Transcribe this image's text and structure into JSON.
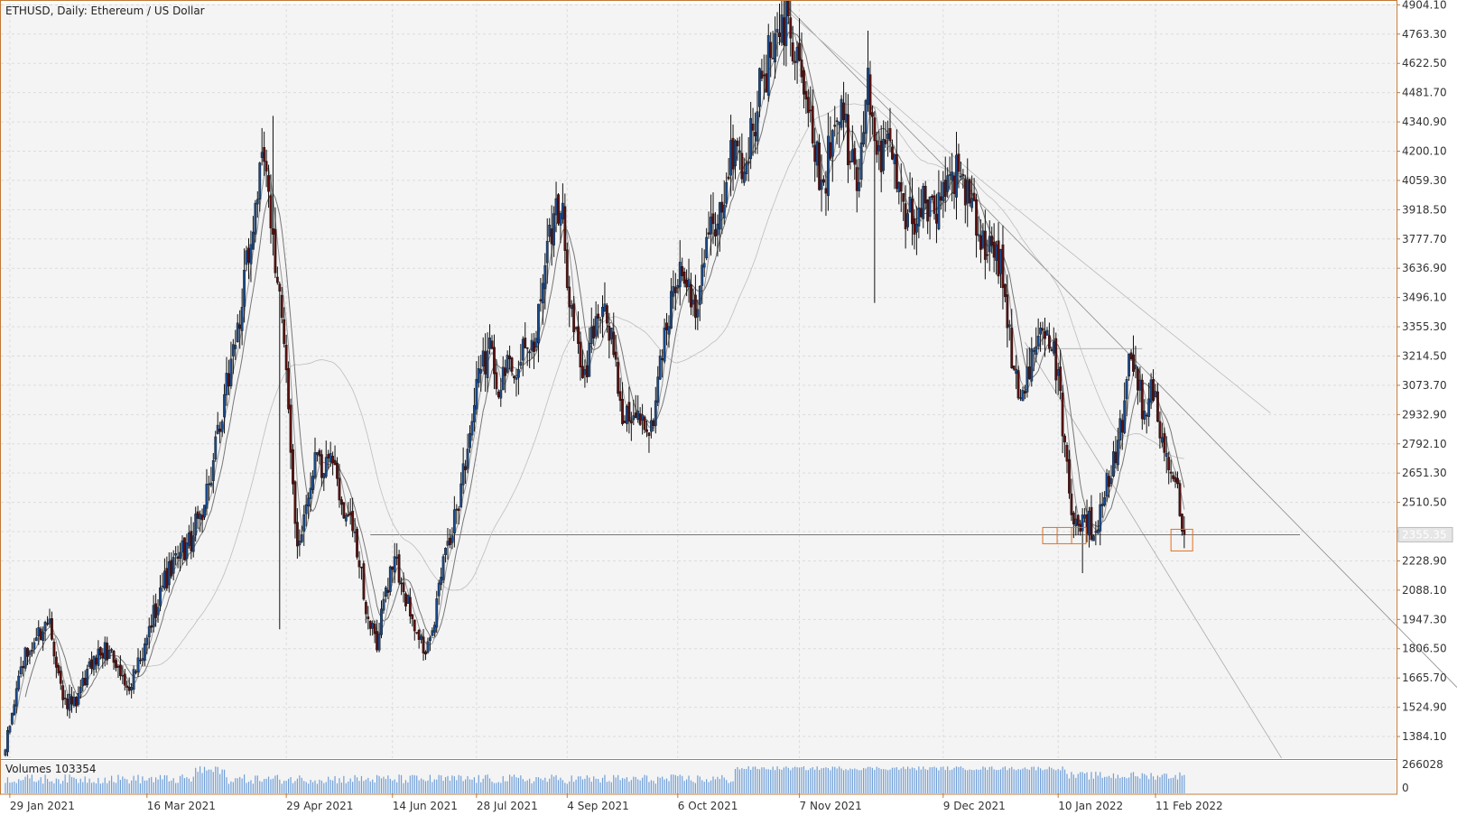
{
  "chart_data": {
    "type": "candlestick",
    "title": "ETHUSD, Daily:  Ethereum / US Dollar",
    "price_ylim": [
      1280,
      4910
    ],
    "y_ticks": [
      "4904.10",
      "4763.30",
      "4622.50",
      "4481.70",
      "4340.90",
      "4200.10",
      "4059.30",
      "3918.50",
      "3777.70",
      "3636.90",
      "3496.10",
      "3355.30",
      "3214.50",
      "3073.70",
      "2932.90",
      "2792.10",
      "2651.30",
      "2510.50",
      "2369.70",
      "2228.90",
      "2088.10",
      "1947.30",
      "1806.50",
      "1665.70",
      "1524.90",
      "1384.10"
    ],
    "x_labels": [
      "29 Jan 2021",
      "16 Mar 2021",
      "29 Apr 2021",
      "14 Jun 2021",
      "28 Jul 2021",
      "4 Sep 2021",
      "6 Oct 2021",
      "7 Nov 2021",
      "9 Dec 2021",
      "10 Jan 2022",
      "11 Feb 2022"
    ],
    "current_price_label": "2355.35",
    "support_level": 2355,
    "grid": true,
    "anchors": [
      [
        0,
        1320
      ],
      [
        7,
        1720
      ],
      [
        14,
        1860
      ],
      [
        20,
        1950
      ],
      [
        26,
        1560
      ],
      [
        32,
        1530
      ],
      [
        40,
        1770
      ],
      [
        47,
        1800
      ],
      [
        55,
        1620
      ],
      [
        62,
        1760
      ],
      [
        70,
        2100
      ],
      [
        78,
        2240
      ],
      [
        85,
        2350
      ],
      [
        92,
        2600
      ],
      [
        98,
        2900
      ],
      [
        102,
        3200
      ],
      [
        107,
        3450
      ],
      [
        113,
        3950
      ],
      [
        117,
        4150
      ],
      [
        121,
        3800
      ],
      [
        125,
        3400
      ],
      [
        129,
        2750
      ],
      [
        132,
        2300
      ],
      [
        136,
        2500
      ],
      [
        140,
        2750
      ],
      [
        144,
        2650
      ],
      [
        148,
        2700
      ],
      [
        152,
        2500
      ],
      [
        156,
        2450
      ],
      [
        160,
        2200
      ],
      [
        164,
        1950
      ],
      [
        168,
        1800
      ],
      [
        172,
        2100
      ],
      [
        176,
        2250
      ],
      [
        180,
        2080
      ],
      [
        184,
        1950
      ],
      [
        187,
        1850
      ],
      [
        190,
        1780
      ],
      [
        194,
        1920
      ],
      [
        198,
        2250
      ],
      [
        202,
        2350
      ],
      [
        206,
        2600
      ],
      [
        211,
        2900
      ],
      [
        215,
        3150
      ],
      [
        220,
        3250
      ],
      [
        224,
        3050
      ],
      [
        228,
        3200
      ],
      [
        232,
        3150
      ],
      [
        236,
        3250
      ],
      [
        240,
        3300
      ],
      [
        244,
        3650
      ],
      [
        248,
        3900
      ],
      [
        252,
        3950
      ],
      [
        255,
        3450
      ],
      [
        258,
        3350
      ],
      [
        262,
        3150
      ],
      [
        266,
        3300
      ],
      [
        270,
        3450
      ],
      [
        274,
        3350
      ],
      [
        278,
        3000
      ],
      [
        282,
        2900
      ],
      [
        286,
        2950
      ],
      [
        290,
        2850
      ],
      [
        294,
        3000
      ],
      [
        298,
        3350
      ],
      [
        302,
        3550
      ],
      [
        306,
        3600
      ],
      [
        310,
        3450
      ],
      [
        314,
        3550
      ],
      [
        318,
        3800
      ],
      [
        322,
        3850
      ],
      [
        326,
        4050
      ],
      [
        330,
        4250
      ],
      [
        334,
        4100
      ],
      [
        338,
        4300
      ],
      [
        342,
        4550
      ],
      [
        346,
        4650
      ],
      [
        350,
        4750
      ],
      [
        354,
        4850
      ],
      [
        358,
        4700
      ],
      [
        362,
        4450
      ],
      [
        366,
        4150
      ],
      [
        370,
        4050
      ],
      [
        374,
        4300
      ],
      [
        378,
        4450
      ],
      [
        382,
        4150
      ],
      [
        386,
        4050
      ],
      [
        390,
        4600
      ],
      [
        393,
        4250
      ],
      [
        396,
        4100
      ],
      [
        400,
        4250
      ],
      [
        404,
        4050
      ],
      [
        408,
        3900
      ],
      [
        412,
        3850
      ],
      [
        416,
        3950
      ],
      [
        420,
        3900
      ],
      [
        424,
        4050
      ],
      [
        428,
        4100
      ],
      [
        432,
        4080
      ],
      [
        436,
        3950
      ],
      [
        440,
        3800
      ],
      [
        444,
        3700
      ],
      [
        448,
        3750
      ],
      [
        452,
        3500
      ],
      [
        456,
        3150
      ],
      [
        460,
        3050
      ],
      [
        464,
        3250
      ],
      [
        468,
        3350
      ],
      [
        472,
        3250
      ],
      [
        476,
        3150
      ],
      [
        479,
        2800
      ],
      [
        482,
        2450
      ],
      [
        485,
        2400
      ],
      [
        488,
        2450
      ],
      [
        492,
        2350
      ],
      [
        495,
        2500
      ],
      [
        498,
        2650
      ],
      [
        502,
        2700
      ],
      [
        506,
        3000
      ],
      [
        509,
        3200
      ],
      [
        512,
        3050
      ],
      [
        515,
        2950
      ],
      [
        518,
        3100
      ],
      [
        521,
        2900
      ],
      [
        524,
        2750
      ],
      [
        527,
        2650
      ],
      [
        530,
        2600
      ],
      [
        533,
        2355
      ]
    ],
    "ma_fast_period": 5,
    "ma_mid_period": 10,
    "ma_slow_period": 50,
    "trendline_main": {
      "from": [
        354,
        4890
      ],
      "to": [
        575,
        2500
      ]
    },
    "trendline_diag": [
      [
        354,
        4870
      ],
      [
        440,
        4070
      ],
      [
        572,
        2940
      ]
    ],
    "trendline_steep": [
      [
        461,
        3280
      ],
      [
        528,
        1410
      ]
    ],
    "resistance_short": {
      "price": 3250,
      "from": 461,
      "to": 514
    },
    "volume_pane": {
      "label": "Volumes 103354",
      "ticks": [
        "266028",
        "0"
      ],
      "max": 266028
    },
    "colors": {
      "bull": "#1a4a8a",
      "bear": "#5a1010",
      "wick": "#111111",
      "ma": "#777777",
      "ma_slow": "#bdbdbd",
      "trendline": "#8a8a8a",
      "volume": "#6f9fd8",
      "highlight": "#e07020",
      "axis": "#c07838",
      "grid": "#dcdcdc",
      "bg": "#f4f4f4"
    }
  }
}
